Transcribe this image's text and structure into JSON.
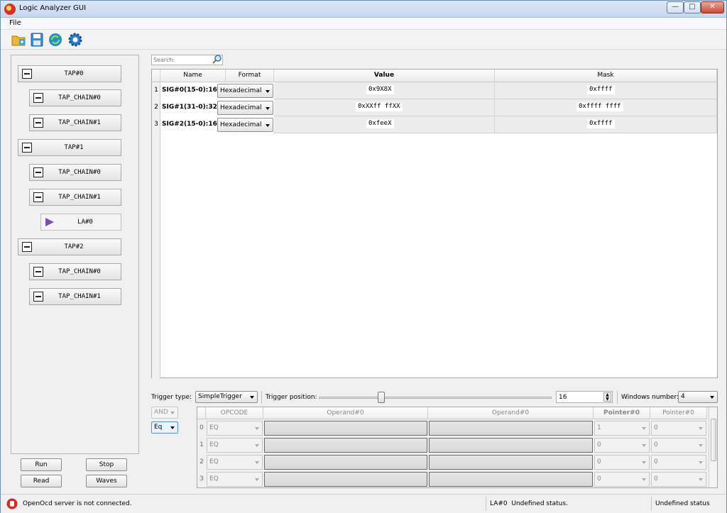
{
  "window": {
    "title": "Logic Analyzer GUI",
    "min": "—",
    "max": "□",
    "close": "✕"
  },
  "menu": {
    "file": "File"
  },
  "toolbar": {
    "icons": [
      "open-folder-icon",
      "save-icon",
      "refresh-icon",
      "settings-gear-icon"
    ]
  },
  "tree": [
    {
      "label": "TAP#0"
    },
    {
      "label": "TAP_CHAIN#0"
    },
    {
      "label": "TAP_CHAIN#1"
    },
    {
      "label": "TAP#1"
    },
    {
      "label": "TAP_CHAIN#0"
    },
    {
      "label": "TAP_CHAIN#1"
    },
    {
      "label": "LA#0"
    },
    {
      "label": "TAP#2"
    },
    {
      "label": "TAP_CHAIN#0"
    },
    {
      "label": "TAP_CHAIN#1"
    }
  ],
  "buttons": {
    "run": "Run",
    "stop": "Stop",
    "read": "Read",
    "waves": "Waves"
  },
  "search": {
    "placeholder": "Search:"
  },
  "signal_table": {
    "headers": {
      "name": "Name",
      "format": "Format",
      "value": "Value",
      "mask": "Mask"
    },
    "rows": [
      {
        "num": "1",
        "name": "SIG#0(15-0):16",
        "format": "Hexadecimal",
        "value": "0x9X8X",
        "mask": "0xffff"
      },
      {
        "num": "2",
        "name": "SIG#1(31-0):32",
        "format": "Hexadecimal",
        "value": "0xXXff ffXX",
        "mask": "0xffff ffff"
      },
      {
        "num": "3",
        "name": "SIG#2(15-0):16",
        "format": "Hexadecimal",
        "value": "0xfeeX",
        "mask": "0xffff"
      }
    ]
  },
  "trigger": {
    "type_label": "Trigger type:",
    "type_value": "SimpleTrigger",
    "position_label": "Trigger position:",
    "position_value": "16",
    "position_fraction": 0.26,
    "windows_label": "Windows number:",
    "windows_value": "4",
    "and_value": "AND",
    "eq_value": "Eq"
  },
  "trigger_grid": {
    "headers": {
      "opcode": "OPCODE",
      "operand0": "Operand#0",
      "operand1": "Operand#0",
      "pointer0": "Pointer#0",
      "pointer1": "Pointer#0"
    },
    "rows": [
      {
        "num": "0",
        "opcode": "EQ",
        "p0": "1",
        "p1": "0"
      },
      {
        "num": "1",
        "opcode": "EQ",
        "p0": "0",
        "p1": "0"
      },
      {
        "num": "2",
        "opcode": "EQ",
        "p0": "0",
        "p1": "0"
      },
      {
        "num": "3",
        "opcode": "EQ",
        "p0": "0",
        "p1": "0"
      }
    ]
  },
  "status": {
    "message": "OpenOcd server is not connected.",
    "la_status": "LA#0  Undefined status.",
    "right_status": "Undefined status"
  }
}
